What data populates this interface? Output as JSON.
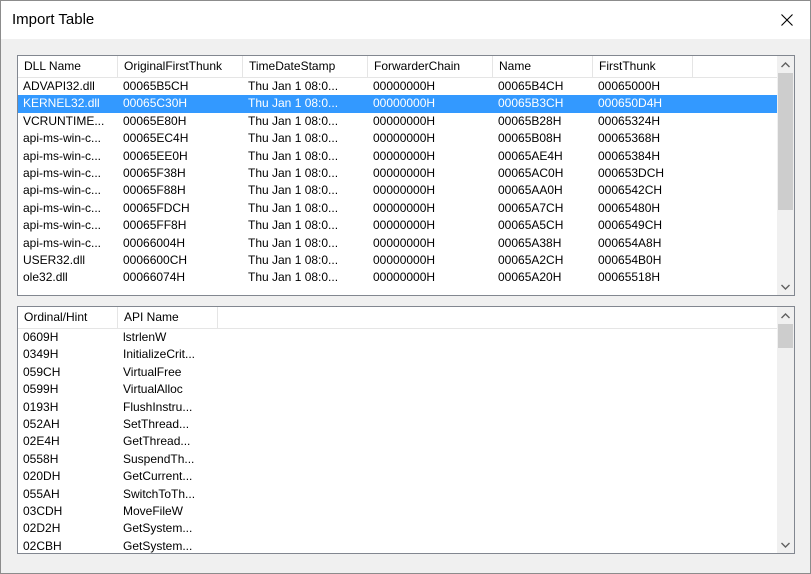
{
  "window": {
    "title": "Import Table"
  },
  "dll_table": {
    "columns": [
      "DLL Name",
      "OriginalFirstThunk",
      "TimeDateStamp",
      "ForwarderChain",
      "Name",
      "FirstThunk"
    ],
    "selected_row": 1,
    "rows": [
      [
        "ADVAPI32.dll",
        "00065B5CH",
        "Thu Jan  1 08:0...",
        "00000000H",
        "00065B4CH",
        "00065000H"
      ],
      [
        "KERNEL32.dll",
        "00065C30H",
        "Thu Jan  1 08:0...",
        "00000000H",
        "00065B3CH",
        "000650D4H"
      ],
      [
        "VCRUNTIME...",
        "00065E80H",
        "Thu Jan  1 08:0...",
        "00000000H",
        "00065B28H",
        "00065324H"
      ],
      [
        "api-ms-win-c...",
        "00065EC4H",
        "Thu Jan  1 08:0...",
        "00000000H",
        "00065B08H",
        "00065368H"
      ],
      [
        "api-ms-win-c...",
        "00065EE0H",
        "Thu Jan  1 08:0...",
        "00000000H",
        "00065AE4H",
        "00065384H"
      ],
      [
        "api-ms-win-c...",
        "00065F38H",
        "Thu Jan  1 08:0...",
        "00000000H",
        "00065AC0H",
        "000653DCH"
      ],
      [
        "api-ms-win-c...",
        "00065F88H",
        "Thu Jan  1 08:0...",
        "00000000H",
        "00065AA0H",
        "0006542CH"
      ],
      [
        "api-ms-win-c...",
        "00065FDCH",
        "Thu Jan  1 08:0...",
        "00000000H",
        "00065A7CH",
        "00065480H"
      ],
      [
        "api-ms-win-c...",
        "00065FF8H",
        "Thu Jan  1 08:0...",
        "00000000H",
        "00065A5CH",
        "0006549CH"
      ],
      [
        "api-ms-win-c...",
        "00066004H",
        "Thu Jan  1 08:0...",
        "00000000H",
        "00065A38H",
        "000654A8H"
      ],
      [
        "USER32.dll",
        "0006600CH",
        "Thu Jan  1 08:0...",
        "00000000H",
        "00065A2CH",
        "000654B0H"
      ],
      [
        "ole32.dll",
        "00066074H",
        "Thu Jan  1 08:0...",
        "00000000H",
        "00065A20H",
        "00065518H"
      ]
    ]
  },
  "api_table": {
    "columns": [
      "Ordinal/Hint",
      "API Name"
    ],
    "rows": [
      [
        "0609H",
        "lstrlenW"
      ],
      [
        "0349H",
        "InitializeCrit..."
      ],
      [
        "059CH",
        "VirtualFree"
      ],
      [
        "0599H",
        "VirtualAlloc"
      ],
      [
        "0193H",
        "FlushInstru..."
      ],
      [
        "052AH",
        "SetThread..."
      ],
      [
        "02E4H",
        "GetThread..."
      ],
      [
        "0558H",
        "SuspendTh..."
      ],
      [
        "020DH",
        "GetCurrent..."
      ],
      [
        "055AH",
        "SwitchToTh..."
      ],
      [
        "03CDH",
        "MoveFileW"
      ],
      [
        "02D2H",
        "GetSystem..."
      ],
      [
        "02CBH",
        "GetSystem..."
      ]
    ]
  },
  "colors": {
    "selection": "#3399ff",
    "border": "#828790",
    "scroll_thumb": "#cdcdcd"
  },
  "icons": {
    "close": "close-icon",
    "scroll_up": "chevron-up-icon",
    "scroll_down": "chevron-down-icon"
  }
}
